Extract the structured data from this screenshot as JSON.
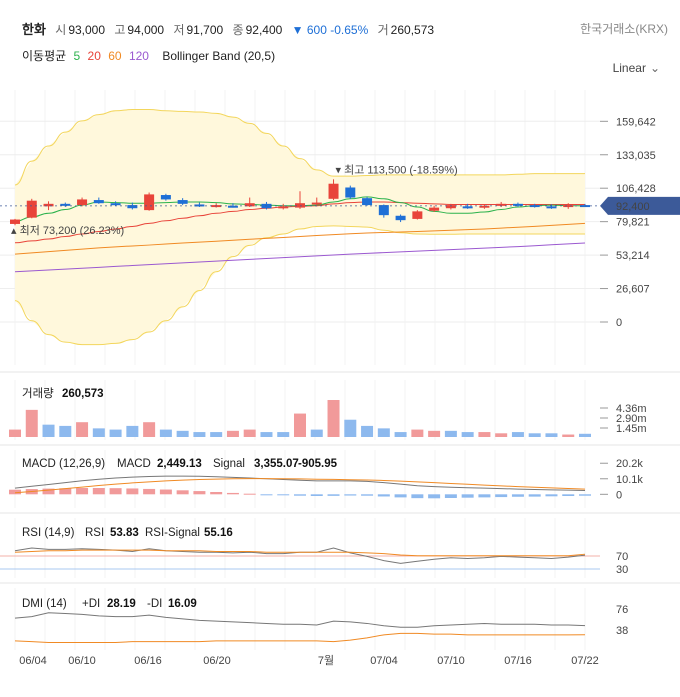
{
  "header": {
    "name": "한화",
    "open_label": "시",
    "open": "93,000",
    "high_label": "고",
    "high": "94,000",
    "low_label": "저",
    "low": "91,700",
    "close_label": "종",
    "close": "92,400",
    "change_arrow": "▼",
    "change": "600",
    "change_pct": "-0.65%",
    "volume_label": "거",
    "volume": "260,573",
    "exchange": "한국거래소(KRX)"
  },
  "indicators": {
    "ma_label": "이동평균",
    "ma": [
      {
        "period": "5",
        "color": "#2bb24c"
      },
      {
        "period": "20",
        "color": "#e8443a"
      },
      {
        "period": "60",
        "color": "#f08a24"
      },
      {
        "period": "120",
        "color": "#9b59d0"
      }
    ],
    "bollinger": "Bollinger Band (20,5)"
  },
  "scale": {
    "label": "Linear",
    "icon": "chevron-down-icon"
  },
  "colors": {
    "up": "#e8443a",
    "down": "#1e6fd6",
    "band_fill": "#fff8dc",
    "band_line": "#f3d65c",
    "price_tag": "#3c5a99"
  },
  "chart_data": [
    {
      "type": "candlestick",
      "title": "한화",
      "x": [
        "06/04",
        "06/10",
        "06/16",
        "06/20",
        "7월",
        "07/04",
        "07/10",
        "07/16",
        "07/22"
      ],
      "ylim": [
        0,
        175000
      ],
      "y_ticks": [
        "159,642",
        "133,035",
        "106,428",
        "79,821",
        "53,214",
        "26,607",
        "0"
      ],
      "last_price": "92,400",
      "annotations": {
        "high": "최고 113,500 (-18.59%)",
        "low": "최저 73,200 (26.23%)"
      },
      "candles": [
        [
          78000,
          82000,
          77000,
          81500
        ],
        [
          83000,
          98000,
          82500,
          96500
        ],
        [
          92000,
          96000,
          89000,
          94000
        ],
        [
          94000,
          95000,
          91500,
          93000
        ],
        [
          93000,
          99000,
          92000,
          97500
        ],
        [
          97000,
          99000,
          94000,
          94500
        ],
        [
          94500,
          96000,
          92500,
          93000
        ],
        [
          93000,
          95000,
          89500,
          90500
        ],
        [
          89000,
          103000,
          88500,
          101500
        ],
        [
          101000,
          102000,
          96500,
          97500
        ],
        [
          97000,
          98500,
          93000,
          94000
        ],
        [
          93500,
          95000,
          91500,
          92500
        ],
        [
          92500,
          94500,
          91000,
          93000
        ],
        [
          92500,
          94500,
          91000,
          92000
        ],
        [
          92000,
          99000,
          91500,
          94500
        ],
        [
          94000,
          95500,
          89500,
          90500
        ],
        [
          90500,
          94000,
          89500,
          92000
        ],
        [
          91000,
          104000,
          90000,
          94500
        ],
        [
          94000,
          99000,
          92000,
          95000
        ],
        [
          98000,
          113500,
          97000,
          110000
        ],
        [
          107000,
          108500,
          98000,
          99000
        ],
        [
          98500,
          99500,
          92500,
          93000
        ],
        [
          93000,
          93500,
          83000,
          85000
        ],
        [
          84500,
          85500,
          79500,
          81000
        ],
        [
          82000,
          89000,
          81500,
          88000
        ],
        [
          88500,
          92500,
          87500,
          91000
        ],
        [
          90500,
          94000,
          89500,
          93000
        ],
        [
          92000,
          94000,
          90000,
          91500
        ],
        [
          91500,
          93500,
          90000,
          92500
        ],
        [
          92500,
          95500,
          91500,
          94000
        ],
        [
          94000,
          95000,
          91500,
          93000
        ],
        [
          93000,
          94000,
          91000,
          92000
        ],
        [
          92000,
          93500,
          90000,
          91000
        ],
        [
          91500,
          94500,
          90000,
          93000
        ],
        [
          93000,
          94000,
          91700,
          92400
        ]
      ],
      "ma5": [
        80000,
        83500,
        86500,
        89500,
        93000,
        95500,
        95000,
        94500,
        94500,
        95000,
        95500,
        95500,
        95000,
        94000,
        93500,
        93000,
        92500,
        92500,
        93000,
        95500,
        98000,
        99500,
        98000,
        95000,
        91500,
        88000,
        86500,
        86500,
        87500,
        89500,
        91500,
        92500,
        93000,
        92500,
        92400
      ],
      "ma20": [
        63000,
        64500,
        66000,
        68000,
        70000,
        72000,
        74000,
        76000,
        78500,
        80500,
        82500,
        84500,
        86500,
        88000,
        89500,
        90500,
        91500,
        92000,
        92500,
        94000,
        95000,
        95500,
        95500,
        95000,
        94500,
        94000,
        93500,
        93500,
        93500,
        93500,
        93500,
        93500,
        93500,
        93500,
        93500
      ],
      "ma60": [
        54000,
        55000,
        56000,
        57000,
        58000,
        59000,
        59800,
        60500,
        61200,
        62000,
        62800,
        63500,
        64200,
        65000,
        65800,
        66500,
        67200,
        68000,
        68800,
        69500,
        70200,
        70800,
        71200,
        71600,
        72000,
        72500,
        73000,
        73500,
        74000,
        74700,
        75400,
        76100,
        76900,
        77700,
        78500
      ],
      "ma120": [
        40000,
        40700,
        41400,
        42100,
        42800,
        43500,
        44200,
        44900,
        45600,
        46300,
        47000,
        47700,
        48400,
        49100,
        49800,
        50500,
        51200,
        51900,
        52600,
        53300,
        54000,
        54600,
        55200,
        55800,
        56400,
        57000,
        57600,
        58200,
        58800,
        59400,
        60000,
        60700,
        61400,
        62100,
        62800
      ],
      "bb_upper": [
        109000,
        128000,
        140000,
        151000,
        160000,
        165000,
        168000,
        169000,
        169000,
        168000,
        167500,
        167000,
        166000,
        163000,
        158000,
        150000,
        140000,
        130000,
        121000,
        116000,
        116000,
        116500,
        117000,
        117000,
        117000,
        117000,
        117000,
        117000,
        117000,
        117000,
        117500,
        118000,
        118000,
        118000,
        118000
      ],
      "bb_lower": [
        17000,
        1000,
        -10000,
        -16000,
        -18000,
        -18000,
        -17000,
        -14000,
        -8000,
        1000,
        12000,
        25000,
        40000,
        52000,
        61000,
        67000,
        70000,
        74000,
        76000,
        76500,
        76000,
        75500,
        73000,
        71000,
        70000,
        69800,
        69800,
        70000,
        70000,
        70000,
        70000,
        70000,
        70000,
        70000,
        70000
      ]
    },
    {
      "type": "bar",
      "title": "거래량",
      "value_label": "260,573",
      "y_ticks": [
        "4.36m",
        "2.90m",
        "1.45m"
      ],
      "values": [
        0.6,
        2.2,
        1.0,
        0.9,
        1.2,
        0.7,
        0.6,
        0.9,
        1.2,
        0.6,
        0.5,
        0.4,
        0.4,
        0.5,
        0.6,
        0.4,
        0.4,
        1.9,
        0.6,
        3.0,
        1.4,
        0.9,
        0.7,
        0.4,
        0.6,
        0.5,
        0.5,
        0.4,
        0.4,
        0.3,
        0.4,
        0.3,
        0.3,
        0.2,
        0.26
      ],
      "up": [
        true,
        true,
        false,
        false,
        true,
        false,
        false,
        false,
        true,
        false,
        false,
        false,
        false,
        true,
        true,
        false,
        false,
        true,
        false,
        true,
        false,
        false,
        false,
        false,
        true,
        true,
        false,
        false,
        true,
        true,
        false,
        false,
        false,
        true,
        false
      ]
    },
    {
      "type": "line",
      "title": "MACD (12,26,9)",
      "series_labels": {
        "macd": "MACD",
        "signal": "Signal"
      },
      "macd_value": "2,449.13",
      "signal_value": "3,355.07",
      "osc_value": "-905.95",
      "y_ticks": [
        "20.2k",
        "10.1k",
        "0"
      ],
      "ylim": [
        -5000,
        21000
      ],
      "macd": [
        4000,
        5200,
        6400,
        7600,
        8800,
        9800,
        10600,
        11200,
        11600,
        11800,
        11800,
        11700,
        11400,
        11000,
        10600,
        10100,
        9600,
        9100,
        8700,
        8700,
        8700,
        8400,
        7600,
        6600,
        5600,
        5000,
        4600,
        4300,
        4000,
        3700,
        3400,
        3100,
        2900,
        2700,
        2449
      ],
      "signal": [
        1000,
        1800,
        2700,
        3700,
        4700,
        5700,
        6600,
        7400,
        8100,
        8700,
        9200,
        9600,
        9900,
        10100,
        10200,
        10200,
        10100,
        10000,
        9800,
        9700,
        9500,
        9300,
        9000,
        8600,
        8100,
        7600,
        7000,
        6500,
        6000,
        5500,
        5000,
        4600,
        4200,
        3800,
        3355
      ],
      "osc": [
        3000,
        3400,
        3700,
        3900,
        4100,
        4100,
        4000,
        3800,
        3500,
        3100,
        2600,
        2100,
        1500,
        900,
        400,
        -100,
        -500,
        -900,
        -1100,
        -1000,
        -800,
        -900,
        -1400,
        -2000,
        -2500,
        -2600,
        -2400,
        -2200,
        -2000,
        -1800,
        -1600,
        -1500,
        -1300,
        -1100,
        -906
      ]
    },
    {
      "type": "line",
      "title": "RSI (14,9)",
      "series_labels": {
        "rsi": "RSI",
        "signal": "RSI-Signal"
      },
      "rsi_value": "53.83",
      "signal_value": "55.16",
      "y_ticks": [
        "70",
        "30"
      ],
      "ylim": [
        0,
        100
      ],
      "rsi": [
        60,
        64,
        62,
        62,
        63,
        62,
        61,
        59,
        63,
        60,
        59,
        58,
        58,
        57,
        58,
        56,
        56,
        58,
        58,
        64,
        57,
        52,
        46,
        42,
        45,
        48,
        50,
        49,
        50,
        52,
        51,
        50,
        49,
        51,
        53.83
      ],
      "signal": [
        58,
        59,
        60,
        60,
        61,
        61,
        61,
        61,
        61,
        60,
        60,
        60,
        59,
        59,
        59,
        58,
        58,
        58,
        58,
        58,
        58,
        57,
        56,
        54,
        53,
        53,
        53,
        53,
        53,
        53,
        53,
        53,
        53,
        53,
        55.16
      ]
    },
    {
      "type": "line",
      "title": "DMI (14)",
      "series_labels": {
        "pdi": "+DI",
        "mdi": "-DI"
      },
      "pdi_value": "28.19",
      "mdi_value": "16.09",
      "y_ticks": [
        "76",
        "38"
      ],
      "ylim": [
        0,
        100
      ],
      "pdi": [
        38,
        40,
        45,
        44,
        43,
        41,
        40,
        40,
        42,
        39,
        37,
        35,
        34,
        33,
        32,
        31,
        30,
        30,
        29,
        34,
        33,
        31,
        28,
        26,
        26,
        28,
        29,
        30,
        31,
        30,
        30,
        30,
        29,
        29,
        28.19
      ],
      "mdi": [
        8,
        7,
        6,
        6,
        6,
        6,
        6,
        7,
        7,
        7,
        7,
        7,
        8,
        8,
        8,
        8,
        8,
        8,
        8,
        7,
        9,
        12,
        16,
        18,
        18,
        17,
        17,
        16,
        16,
        16,
        16,
        16,
        16,
        16,
        16.09
      ]
    }
  ]
}
